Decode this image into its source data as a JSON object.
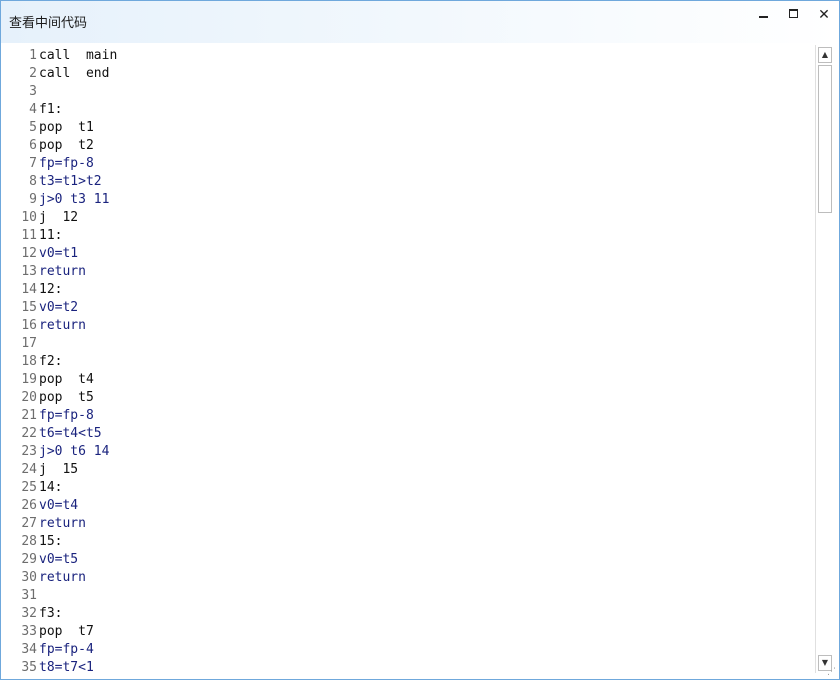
{
  "window": {
    "title": "查看中间代码",
    "min_icon": "minimize-icon",
    "max_icon": "maximize-icon",
    "close_icon": "close-icon",
    "close_glyph": "✕"
  },
  "editor": {
    "lines": [
      {
        "n": "1",
        "t": "call  main"
      },
      {
        "n": "2",
        "t": "call  end"
      },
      {
        "n": "3",
        "t": ""
      },
      {
        "n": "4",
        "t": "f1:"
      },
      {
        "n": "5",
        "t": "pop  t1"
      },
      {
        "n": "6",
        "t": "pop  t2"
      },
      {
        "n": "7",
        "t": "fp=fp-8"
      },
      {
        "n": "8",
        "t": "t3=t1>t2"
      },
      {
        "n": "9",
        "t": "j>0 t3 11"
      },
      {
        "n": "10",
        "t": "j  12"
      },
      {
        "n": "11",
        "t": "11:"
      },
      {
        "n": "12",
        "t": "v0=t1"
      },
      {
        "n": "13",
        "t": "return"
      },
      {
        "n": "14",
        "t": "12:"
      },
      {
        "n": "15",
        "t": "v0=t2"
      },
      {
        "n": "16",
        "t": "return"
      },
      {
        "n": "17",
        "t": ""
      },
      {
        "n": "18",
        "t": "f2:"
      },
      {
        "n": "19",
        "t": "pop  t4"
      },
      {
        "n": "20",
        "t": "pop  t5"
      },
      {
        "n": "21",
        "t": "fp=fp-8"
      },
      {
        "n": "22",
        "t": "t6=t4<t5"
      },
      {
        "n": "23",
        "t": "j>0 t6 14"
      },
      {
        "n": "24",
        "t": "j  15"
      },
      {
        "n": "25",
        "t": "14:"
      },
      {
        "n": "26",
        "t": "v0=t4"
      },
      {
        "n": "27",
        "t": "return"
      },
      {
        "n": "28",
        "t": "15:"
      },
      {
        "n": "29",
        "t": "v0=t5"
      },
      {
        "n": "30",
        "t": "return"
      },
      {
        "n": "31",
        "t": ""
      },
      {
        "n": "32",
        "t": "f3:"
      },
      {
        "n": "33",
        "t": "pop  t7"
      },
      {
        "n": "34",
        "t": "fp=fp-4"
      },
      {
        "n": "35",
        "t": "t8=t7<1"
      }
    ]
  },
  "scrollbar": {
    "up_glyph": "▲",
    "down_glyph": "▼",
    "up_icon": "scroll-up-icon",
    "down_icon": "scroll-down-icon"
  },
  "colors": {
    "title_gradient_start": "#e6f1fb",
    "border": "#6fa8dc",
    "line_number": "#6d6d6d",
    "code_text": "#111111",
    "keyword_text": "#1a237e"
  }
}
